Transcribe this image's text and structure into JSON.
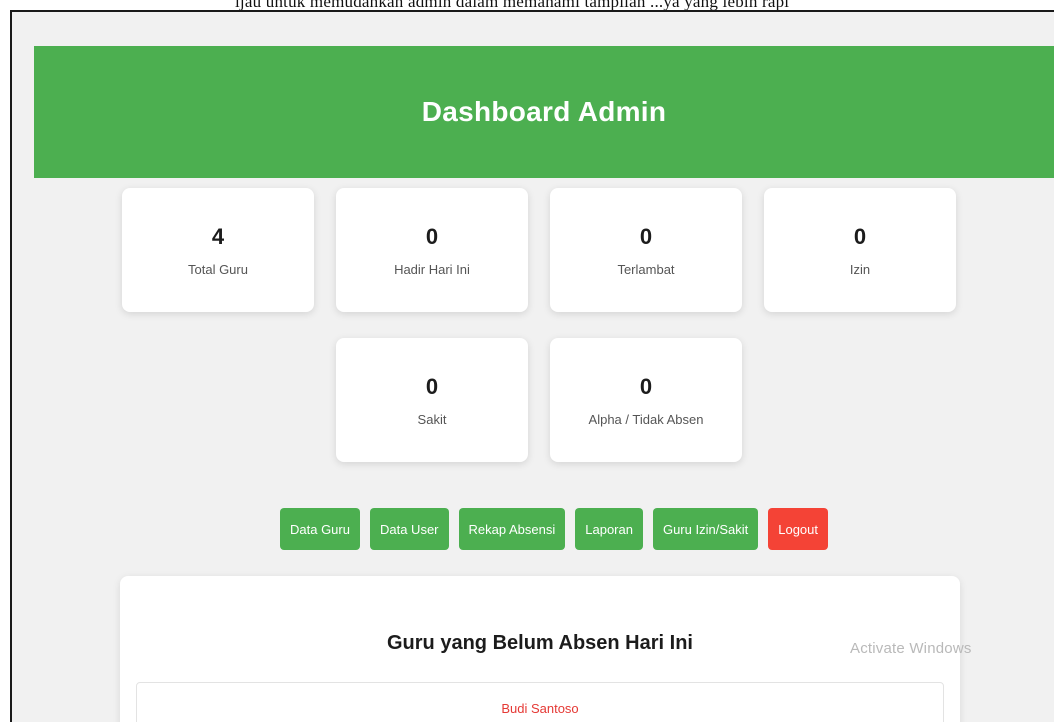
{
  "document": {
    "caption_line": "ijau untuk memudahkan admin dalam memahami tampilan ...ya yang lebih rapi"
  },
  "header": {
    "title": "Dashboard Admin",
    "bg_color": "#4caf50"
  },
  "stats": [
    {
      "value": "4",
      "label": "Total Guru"
    },
    {
      "value": "0",
      "label": "Hadir Hari Ini"
    },
    {
      "value": "0",
      "label": "Terlambat"
    },
    {
      "value": "0",
      "label": "Izin"
    },
    {
      "value": "0",
      "label": "Sakit"
    },
    {
      "value": "0",
      "label": "Alpha / Tidak Absen"
    }
  ],
  "nav_buttons": [
    {
      "label": "Data Guru",
      "color": "#4caf50"
    },
    {
      "label": "Data User",
      "color": "#4caf50"
    },
    {
      "label": "Rekap Absensi",
      "color": "#4caf50"
    },
    {
      "label": "Laporan",
      "color": "#4caf50"
    },
    {
      "label": "Guru Izin/Sakit",
      "color": "#4caf50"
    },
    {
      "label": "Logout",
      "color": "#f44336"
    }
  ],
  "absent_panel": {
    "title": "Guru yang Belum Absen Hari Ini",
    "items": [
      "Budi Santoso"
    ]
  },
  "watermark": "Activate Windows"
}
